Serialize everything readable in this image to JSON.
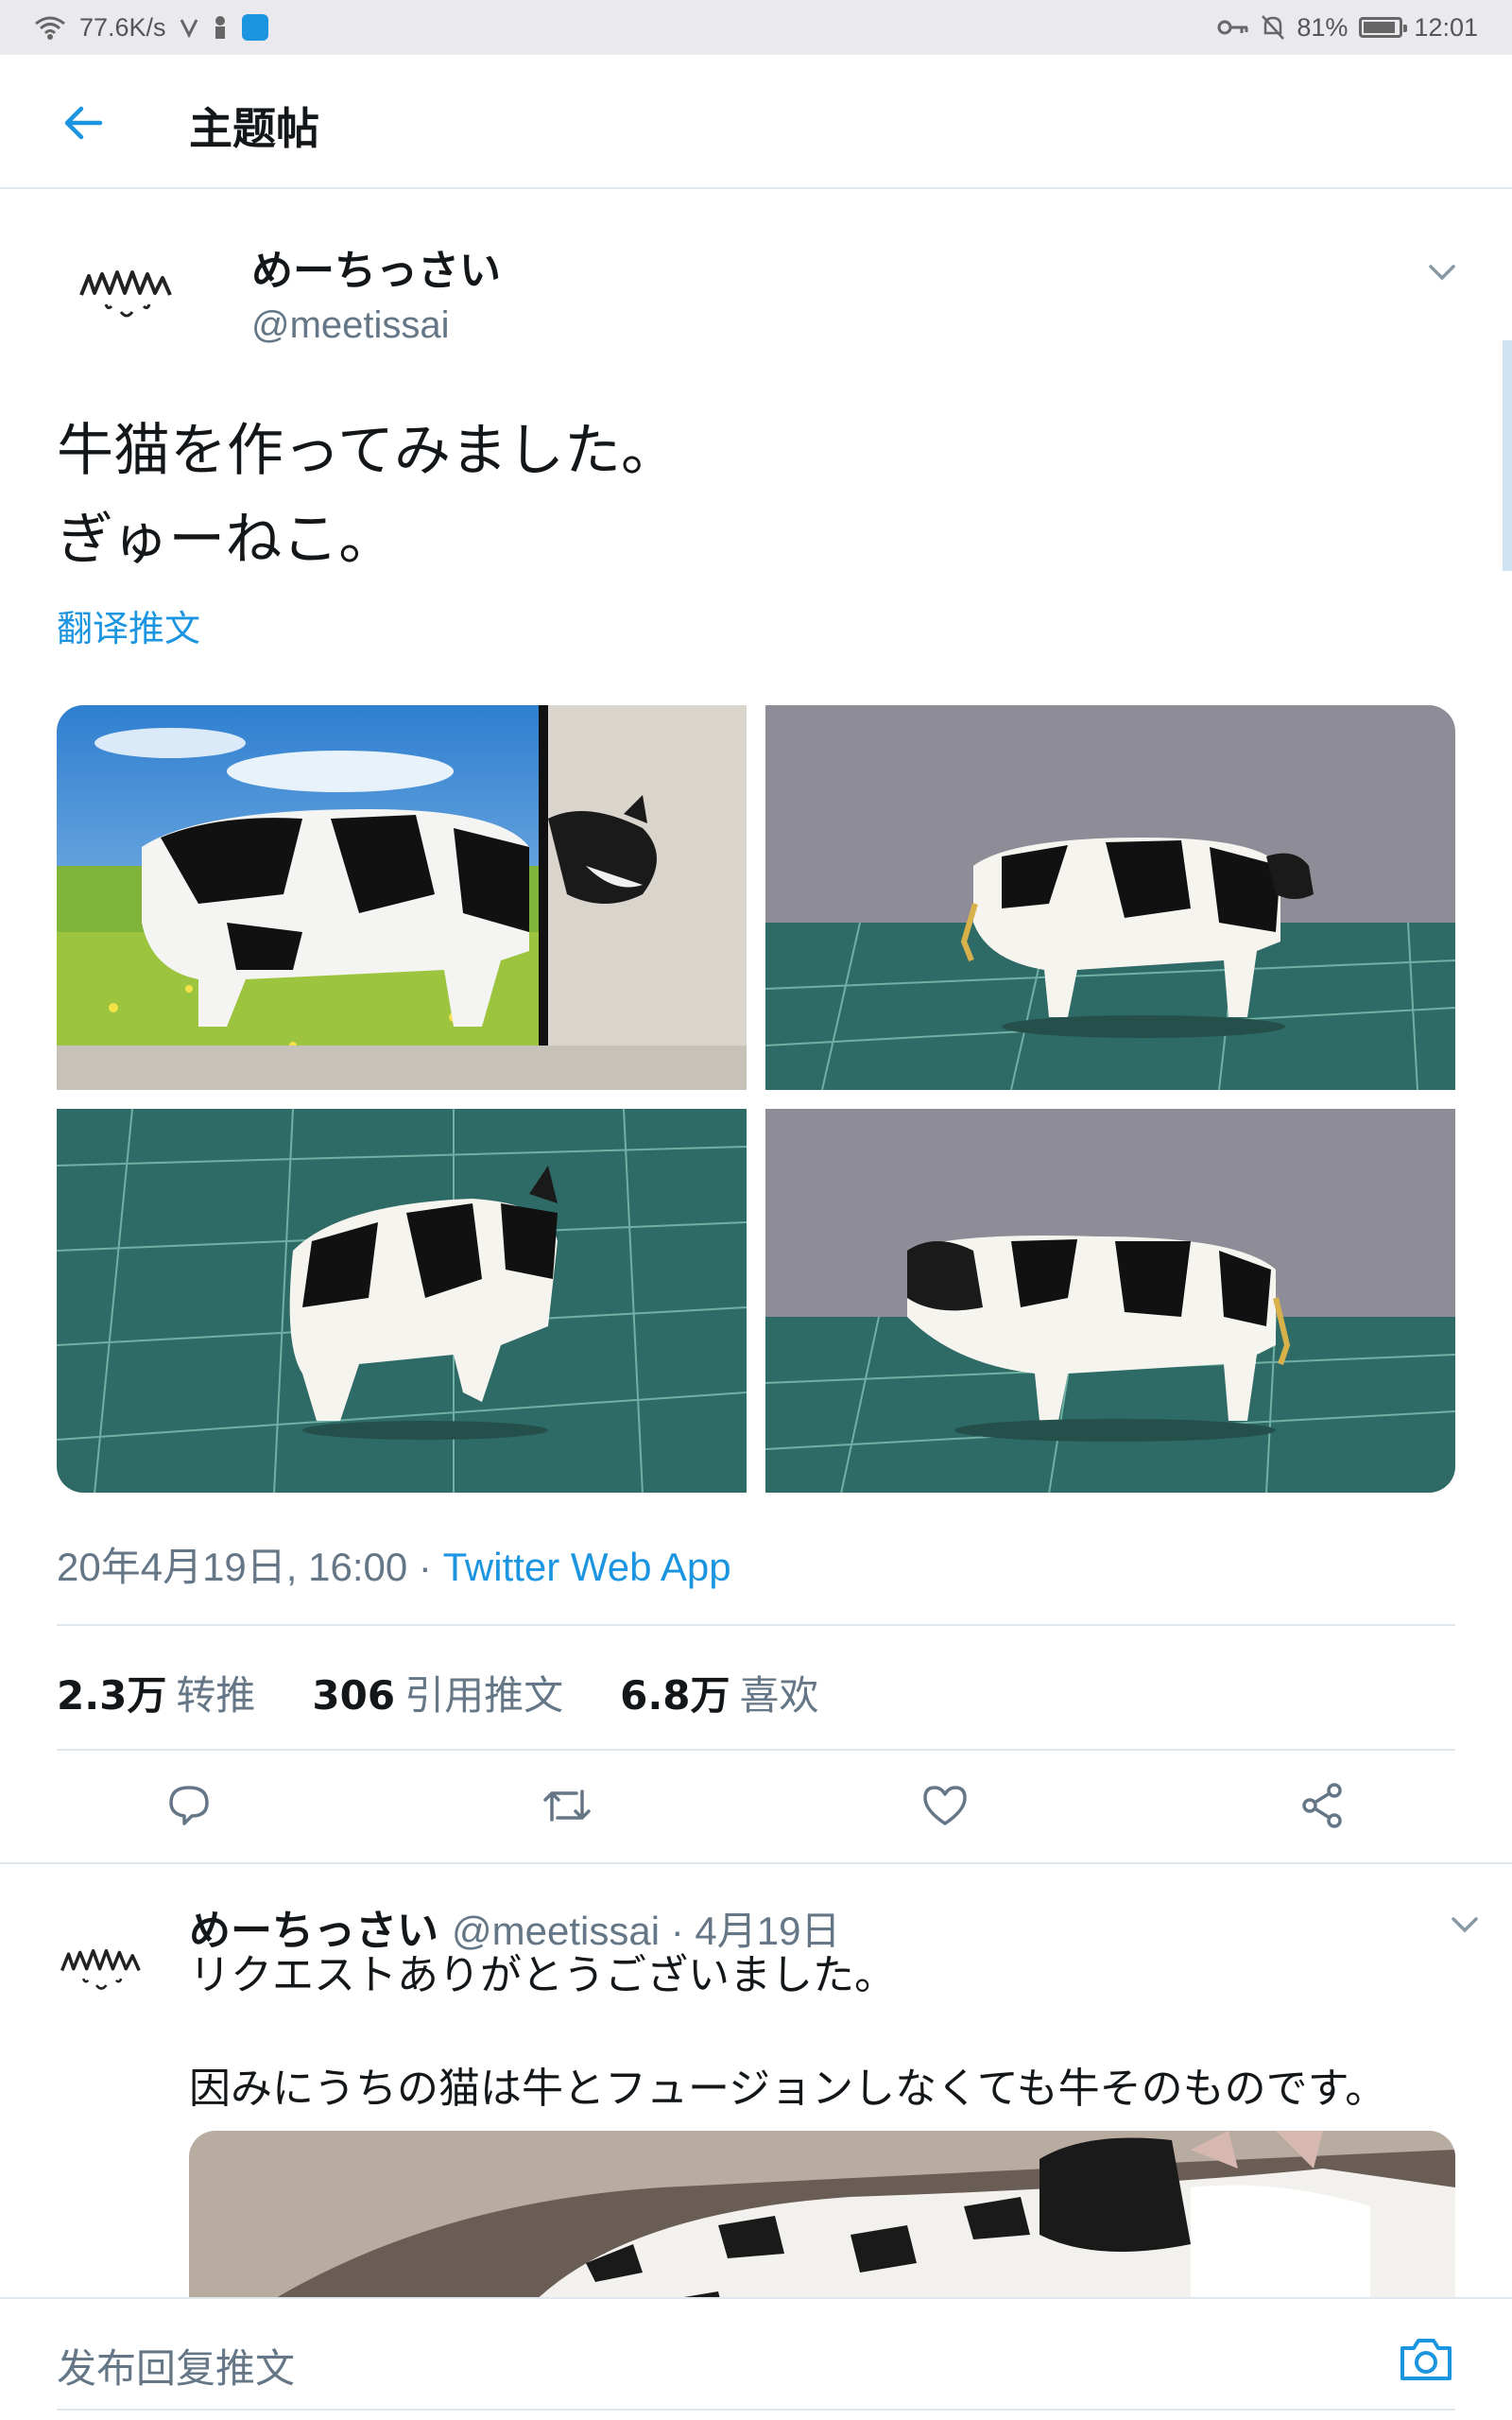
{
  "status_bar": {
    "net_speed": "77.6K/s",
    "battery": "81%",
    "time": "12:01"
  },
  "header": {
    "title": "主题帖"
  },
  "tweet": {
    "display_name": "めーちっさい",
    "handle": "@meetissai",
    "text": "牛猫を作ってみました。\nぎゅーねこ。",
    "translate_label": "翻译推文",
    "timestamp": "20年4月19日, 16:00 · ",
    "source": "Twitter Web App",
    "stats": {
      "retweets_value": "2.3万",
      "retweets_label": "转推",
      "quotes_value": "306",
      "quotes_label": "引用推文",
      "likes_value": "6.8万",
      "likes_label": "喜欢"
    },
    "actions": [
      "reply-icon",
      "retweet-icon",
      "like-icon",
      "share-icon"
    ]
  },
  "reply": {
    "display_name": "めーちっさい",
    "handle_date": "@meetissai · 4月19日",
    "text": "リクエストありがとうございました。\n\n因みにうちの猫は牛とフュージョンしなくても牛そのものです。"
  },
  "compose": {
    "placeholder": "发布回复推文"
  },
  "colors": {
    "accent": "#1b95e0",
    "secondary_text": "#657786",
    "divider": "#e1e8ed"
  }
}
